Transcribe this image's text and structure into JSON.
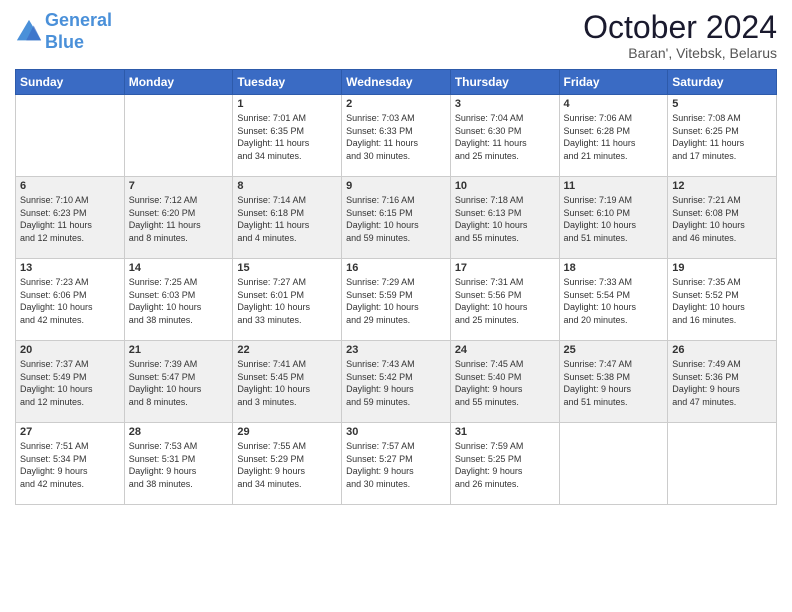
{
  "header": {
    "logo_line1": "General",
    "logo_line2": "Blue",
    "month_title": "October 2024",
    "location": "Baran', Vitebsk, Belarus"
  },
  "weekdays": [
    "Sunday",
    "Monday",
    "Tuesday",
    "Wednesday",
    "Thursday",
    "Friday",
    "Saturday"
  ],
  "weeks": [
    [
      {
        "day": "",
        "content": ""
      },
      {
        "day": "",
        "content": ""
      },
      {
        "day": "1",
        "content": "Sunrise: 7:01 AM\nSunset: 6:35 PM\nDaylight: 11 hours\nand 34 minutes."
      },
      {
        "day": "2",
        "content": "Sunrise: 7:03 AM\nSunset: 6:33 PM\nDaylight: 11 hours\nand 30 minutes."
      },
      {
        "day": "3",
        "content": "Sunrise: 7:04 AM\nSunset: 6:30 PM\nDaylight: 11 hours\nand 25 minutes."
      },
      {
        "day": "4",
        "content": "Sunrise: 7:06 AM\nSunset: 6:28 PM\nDaylight: 11 hours\nand 21 minutes."
      },
      {
        "day": "5",
        "content": "Sunrise: 7:08 AM\nSunset: 6:25 PM\nDaylight: 11 hours\nand 17 minutes."
      }
    ],
    [
      {
        "day": "6",
        "content": "Sunrise: 7:10 AM\nSunset: 6:23 PM\nDaylight: 11 hours\nand 12 minutes."
      },
      {
        "day": "7",
        "content": "Sunrise: 7:12 AM\nSunset: 6:20 PM\nDaylight: 11 hours\nand 8 minutes."
      },
      {
        "day": "8",
        "content": "Sunrise: 7:14 AM\nSunset: 6:18 PM\nDaylight: 11 hours\nand 4 minutes."
      },
      {
        "day": "9",
        "content": "Sunrise: 7:16 AM\nSunset: 6:15 PM\nDaylight: 10 hours\nand 59 minutes."
      },
      {
        "day": "10",
        "content": "Sunrise: 7:18 AM\nSunset: 6:13 PM\nDaylight: 10 hours\nand 55 minutes."
      },
      {
        "day": "11",
        "content": "Sunrise: 7:19 AM\nSunset: 6:10 PM\nDaylight: 10 hours\nand 51 minutes."
      },
      {
        "day": "12",
        "content": "Sunrise: 7:21 AM\nSunset: 6:08 PM\nDaylight: 10 hours\nand 46 minutes."
      }
    ],
    [
      {
        "day": "13",
        "content": "Sunrise: 7:23 AM\nSunset: 6:06 PM\nDaylight: 10 hours\nand 42 minutes."
      },
      {
        "day": "14",
        "content": "Sunrise: 7:25 AM\nSunset: 6:03 PM\nDaylight: 10 hours\nand 38 minutes."
      },
      {
        "day": "15",
        "content": "Sunrise: 7:27 AM\nSunset: 6:01 PM\nDaylight: 10 hours\nand 33 minutes."
      },
      {
        "day": "16",
        "content": "Sunrise: 7:29 AM\nSunset: 5:59 PM\nDaylight: 10 hours\nand 29 minutes."
      },
      {
        "day": "17",
        "content": "Sunrise: 7:31 AM\nSunset: 5:56 PM\nDaylight: 10 hours\nand 25 minutes."
      },
      {
        "day": "18",
        "content": "Sunrise: 7:33 AM\nSunset: 5:54 PM\nDaylight: 10 hours\nand 20 minutes."
      },
      {
        "day": "19",
        "content": "Sunrise: 7:35 AM\nSunset: 5:52 PM\nDaylight: 10 hours\nand 16 minutes."
      }
    ],
    [
      {
        "day": "20",
        "content": "Sunrise: 7:37 AM\nSunset: 5:49 PM\nDaylight: 10 hours\nand 12 minutes."
      },
      {
        "day": "21",
        "content": "Sunrise: 7:39 AM\nSunset: 5:47 PM\nDaylight: 10 hours\nand 8 minutes."
      },
      {
        "day": "22",
        "content": "Sunrise: 7:41 AM\nSunset: 5:45 PM\nDaylight: 10 hours\nand 3 minutes."
      },
      {
        "day": "23",
        "content": "Sunrise: 7:43 AM\nSunset: 5:42 PM\nDaylight: 9 hours\nand 59 minutes."
      },
      {
        "day": "24",
        "content": "Sunrise: 7:45 AM\nSunset: 5:40 PM\nDaylight: 9 hours\nand 55 minutes."
      },
      {
        "day": "25",
        "content": "Sunrise: 7:47 AM\nSunset: 5:38 PM\nDaylight: 9 hours\nand 51 minutes."
      },
      {
        "day": "26",
        "content": "Sunrise: 7:49 AM\nSunset: 5:36 PM\nDaylight: 9 hours\nand 47 minutes."
      }
    ],
    [
      {
        "day": "27",
        "content": "Sunrise: 7:51 AM\nSunset: 5:34 PM\nDaylight: 9 hours\nand 42 minutes."
      },
      {
        "day": "28",
        "content": "Sunrise: 7:53 AM\nSunset: 5:31 PM\nDaylight: 9 hours\nand 38 minutes."
      },
      {
        "day": "29",
        "content": "Sunrise: 7:55 AM\nSunset: 5:29 PM\nDaylight: 9 hours\nand 34 minutes."
      },
      {
        "day": "30",
        "content": "Sunrise: 7:57 AM\nSunset: 5:27 PM\nDaylight: 9 hours\nand 30 minutes."
      },
      {
        "day": "31",
        "content": "Sunrise: 7:59 AM\nSunset: 5:25 PM\nDaylight: 9 hours\nand 26 minutes."
      },
      {
        "day": "",
        "content": ""
      },
      {
        "day": "",
        "content": ""
      }
    ]
  ]
}
